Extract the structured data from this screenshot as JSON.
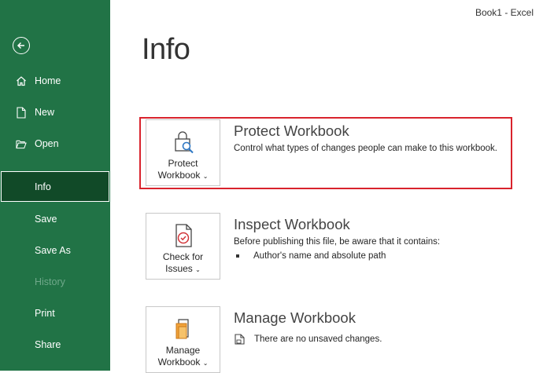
{
  "titlebar": {
    "text": "Book1  -  Excel"
  },
  "sidebar": {
    "items": [
      {
        "label": "Home",
        "icon": "home-icon"
      },
      {
        "label": "New",
        "icon": "new-file-icon"
      },
      {
        "label": "Open",
        "icon": "folder-open-icon"
      },
      {
        "label": "Info"
      },
      {
        "label": "Save"
      },
      {
        "label": "Save As"
      },
      {
        "label": "History"
      },
      {
        "label": "Print"
      },
      {
        "label": "Share"
      }
    ]
  },
  "page": {
    "title": "Info"
  },
  "protect": {
    "tile_line1": "Protect",
    "tile_line2": "Workbook",
    "title": "Protect Workbook",
    "desc": "Control what types of changes people can make to this workbook."
  },
  "inspect": {
    "tile_line1": "Check for",
    "tile_line2": "Issues",
    "title": "Inspect Workbook",
    "desc": "Before publishing this file, be aware that it contains:",
    "bullet": "Author's name and absolute path"
  },
  "manage": {
    "tile_line1": "Manage",
    "tile_line2": "Workbook",
    "title": "Manage Workbook",
    "desc": "There are no unsaved changes."
  },
  "colors": {
    "sidebar": "#217346",
    "active": "#114a28",
    "highlight": "#d9232d"
  }
}
